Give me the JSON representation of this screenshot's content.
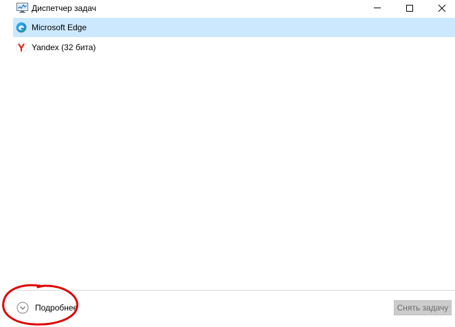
{
  "window": {
    "title": "Диспетчер задач",
    "icon": "task-manager-icon",
    "controls": [
      "minimize-icon",
      "maximize-icon",
      "close-icon"
    ]
  },
  "processes": [
    {
      "label": "Microsoft Edge",
      "icon": "edge-icon",
      "selected": true
    },
    {
      "label": "Yandex (32 бита)",
      "icon": "yandex-icon",
      "selected": false
    }
  ],
  "footer": {
    "details_label": "Подробнее",
    "end_task_label": "Снять задачу",
    "end_task_enabled": false
  },
  "colors": {
    "selection": "#cce8ff",
    "annotation_circle": "#e00000",
    "disabled_button": "#cccccc"
  }
}
